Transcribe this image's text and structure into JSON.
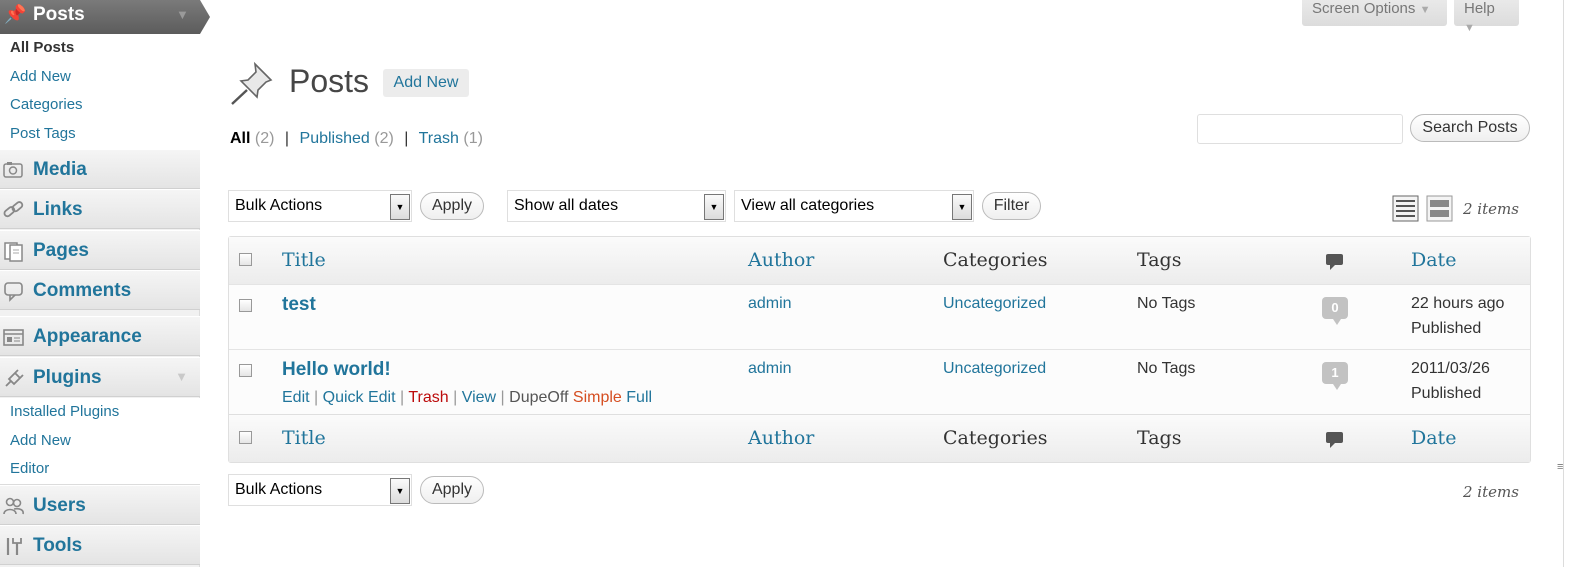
{
  "sidebar": {
    "posts_label": "Posts",
    "posts_submenu": [
      "All Posts",
      "Add New",
      "Categories",
      "Post Tags"
    ],
    "media_label": "Media",
    "links_label": "Links",
    "pages_label": "Pages",
    "comments_label": "Comments",
    "appearance_label": "Appearance",
    "plugins_label": "Plugins",
    "plugins_submenu": [
      "Installed Plugins",
      "Add New",
      "Editor"
    ],
    "users_label": "Users",
    "tools_label": "Tools"
  },
  "screen_meta": {
    "screen_options": "Screen Options",
    "help": "Help"
  },
  "header": {
    "title": "Posts",
    "add_new": "Add New"
  },
  "subsubsub": {
    "all_label": "All",
    "all_count": "(2)",
    "published_label": "Published",
    "published_count": "(2)",
    "trash_label": "Trash",
    "trash_count": "(1)",
    "separator": "|"
  },
  "search": {
    "value": "",
    "button": "Search Posts"
  },
  "tablenav_top": {
    "bulk_actions": "Bulk Actions",
    "apply": "Apply",
    "dates": "Show all dates",
    "categories": "View all categories",
    "filter": "Filter",
    "items_count": "2 items"
  },
  "table": {
    "headers": {
      "title": "Title",
      "author": "Author",
      "categories": "Categories",
      "tags": "Tags",
      "date": "Date"
    },
    "rows": [
      {
        "title": "test",
        "author": "admin",
        "categories": "Uncategorized",
        "tags": "No Tags",
        "comments": "0",
        "date": "22 hours ago",
        "status": "Published"
      },
      {
        "title": "Hello world!",
        "author": "admin",
        "categories": "Uncategorized",
        "tags": "No Tags",
        "comments": "1",
        "date": "2011/03/26",
        "status": "Published"
      }
    ],
    "row_actions": {
      "edit": "Edit",
      "quick_edit": "Quick Edit",
      "trash": "Trash",
      "view": "View",
      "dupe_off": "DupeOff",
      "simple": "Simple",
      "full": "Full"
    }
  },
  "tablenav_bottom": {
    "bulk_actions": "Bulk Actions",
    "apply": "Apply",
    "items_count": "2 items"
  },
  "colors": {
    "link": "#21759b",
    "trash": "#bc0b0b",
    "simple": "#d54e21",
    "current_menu": "#6d6d6d"
  }
}
